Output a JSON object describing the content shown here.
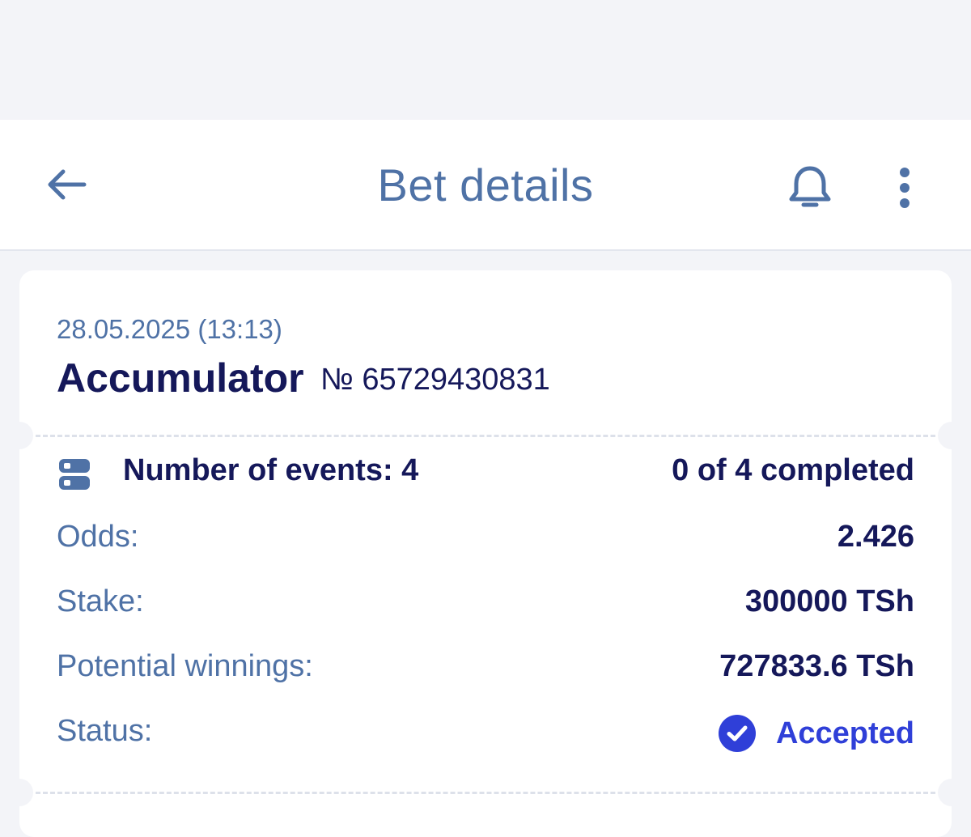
{
  "header": {
    "title": "Bet details",
    "back_icon": "arrow-left-icon",
    "bell_icon": "bell-icon",
    "more_icon": "more-vertical-icon"
  },
  "bet": {
    "date": "28.05.2025 (13:13)",
    "type": "Accumulator",
    "number": "№ 65729430831",
    "events_icon": "events-list-icon",
    "events_label": "Number of events: 4",
    "events_progress": "0 of 4 completed",
    "odds_label": "Odds:",
    "odds_value": "2.426",
    "stake_label": "Stake:",
    "stake_value": "300000 TSh",
    "winnings_label": "Potential winnings:",
    "winnings_value": "727833.6 TSh",
    "status_label": "Status:",
    "status_value": "Accepted",
    "status_icon": "check-circle-icon"
  },
  "colors": {
    "accent": "#4f72a6",
    "primary_text": "#15185a",
    "status_accepted": "#2f3fd8",
    "background": "#f3f4f8"
  }
}
